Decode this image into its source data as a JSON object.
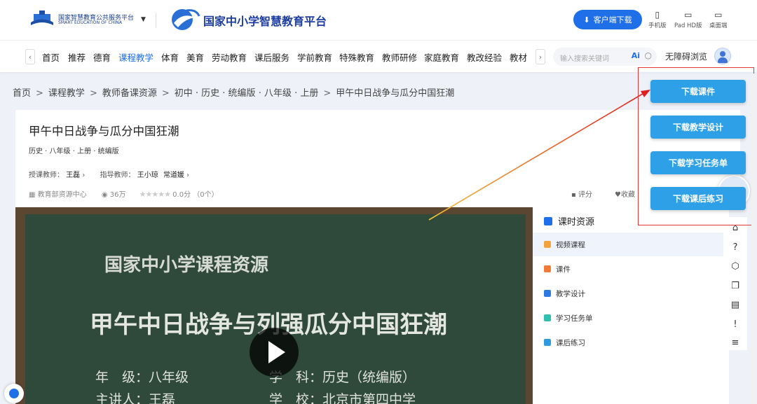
{
  "header": {
    "logo_line1": "国家智慧教育公共服务平台",
    "logo_line2": "SMART EDUCATION OF CHINA",
    "platform_title": "国家中小学智慧教育平台",
    "client_download": "客户端下载",
    "devices": [
      {
        "label": "手机版",
        "icon": "phone-icon"
      },
      {
        "label": "Pad HD版",
        "icon": "tablet-icon"
      },
      {
        "label": "桌面端",
        "icon": "desktop-icon"
      }
    ]
  },
  "nav": {
    "items": [
      "首页",
      "推荐",
      "德育",
      "课程教学",
      "体育",
      "美育",
      "劳动教育",
      "课后服务",
      "学前教育",
      "特殊教育",
      "教师研修",
      "家庭教育",
      "教改经验",
      "教材"
    ],
    "active": "课程教学",
    "search_placeholder": "输入搜索关键词",
    "ai_label": "Ai",
    "accessibility": "无障碍浏览"
  },
  "breadcrumb": [
    "首页",
    "课程教学",
    "教师备课资源",
    "初中 · 历史 · 统编版 · 八年级 · 上册",
    "甲午中日战争与瓜分中国狂潮"
  ],
  "lesson": {
    "title": "甲午中日战争与瓜分中国狂潮",
    "subtitle": "历史 · 八年级 · 上册 · 统编版",
    "teacher_label": "授课教师：",
    "teacher": "王磊",
    "advisor_label": "指导教师：",
    "advisors": [
      "王小琼",
      "常道媛"
    ],
    "source": "教育部资源中心",
    "views": "36万",
    "score": "0.0分",
    "rating_count": "（0个）",
    "rate_label": "评分",
    "fav_label": "收藏"
  },
  "video": {
    "line1": "国家中小学课程资源",
    "line2": "甲午中日战争与列强瓜分中国狂潮",
    "grade_label": "年　级：",
    "grade": "八年级",
    "subject_label": "学　科：",
    "subject": "历史（统编版）",
    "speaker_label": "主讲人：",
    "speaker": "王磊",
    "school_label": "学　校：",
    "school": "北京市第四中学"
  },
  "sidebar": {
    "title": "课时资源",
    "items": [
      {
        "label": "视频课程",
        "color": "#f0a43a"
      },
      {
        "label": "课件",
        "color": "#f07a3a"
      },
      {
        "label": "教学设计",
        "color": "#2f7ae0"
      },
      {
        "label": "学习任务单",
        "color": "#2ebfb0"
      },
      {
        "label": "课后练习",
        "color": "#2f9ae0"
      }
    ]
  },
  "downloads": [
    "下载课件",
    "下载教学设计",
    "下载学习任务单",
    "下载课后练习"
  ],
  "colors": {
    "accent": "#1f6fe8",
    "download_button": "#2ea0e8",
    "highlight_box": "#e23a3a",
    "board": "#2f4a3b"
  }
}
